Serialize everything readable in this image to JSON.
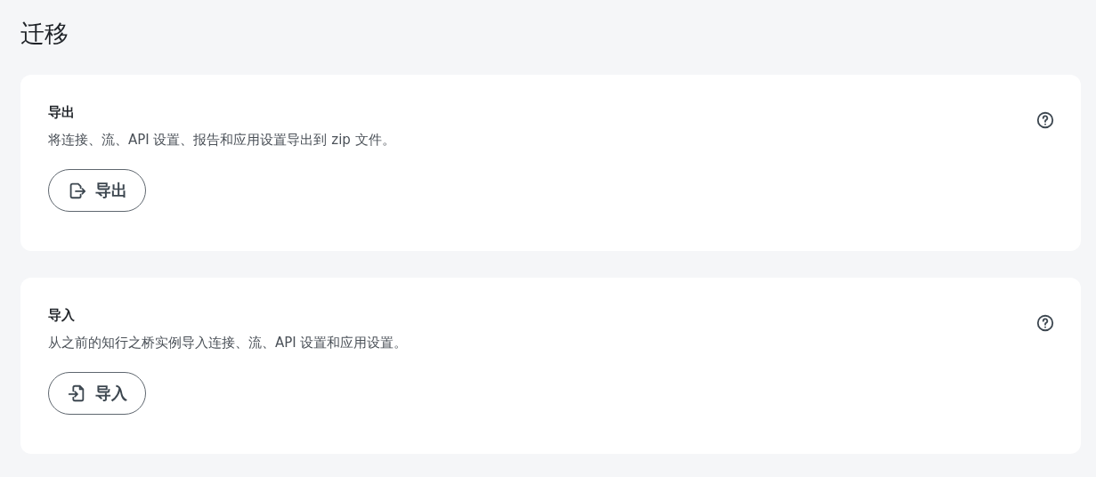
{
  "page": {
    "title": "迁移"
  },
  "sections": [
    {
      "kind": "export",
      "title": "导出",
      "description": "将连接、流、API 设置、报告和应用设置导出到 zip 文件。",
      "button": "导出"
    },
    {
      "kind": "import",
      "title": "导入",
      "description": "从之前的知行之桥实例导入连接、流、API 设置和应用设置。",
      "button": "导入"
    }
  ]
}
